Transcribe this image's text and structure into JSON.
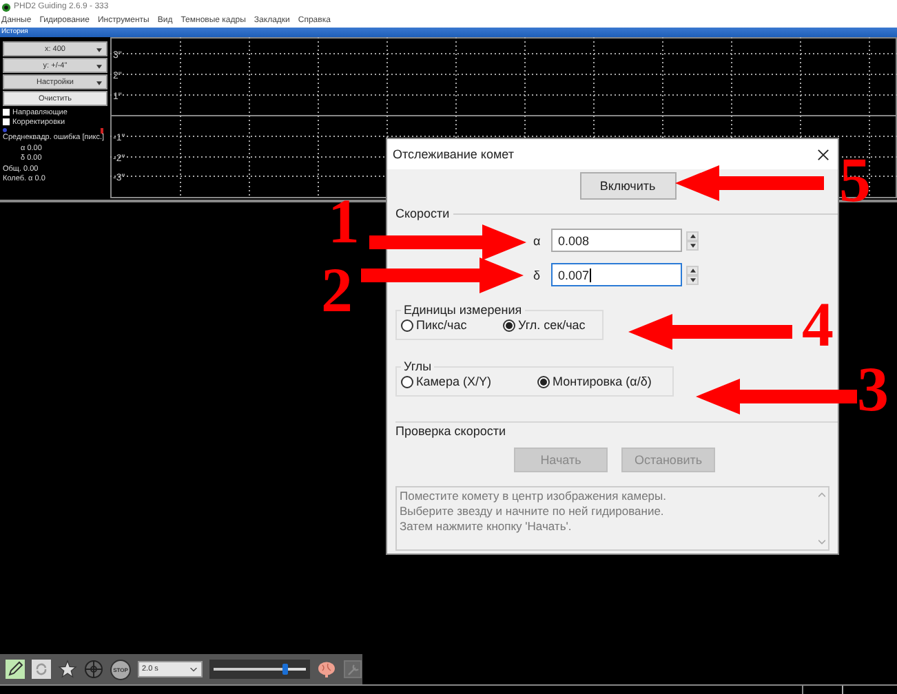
{
  "window": {
    "title": "PHD2 Guiding 2.6.9 - 333"
  },
  "menu": [
    "Данные",
    "Гидирование",
    "Инструменты",
    "Вид",
    "Темновые кадры",
    "Закладки",
    "Справка"
  ],
  "history": {
    "title": "История",
    "dropdowns": [
      "x: 400",
      "y: +/-4\"",
      "Настройки"
    ],
    "clear_button": "Очистить",
    "checkboxes": [
      {
        "label": "Направляющие",
        "checked": false
      },
      {
        "label": "Корректировки",
        "checked": false
      }
    ],
    "rms_label": "Среднеквадр. ошибка [пикс.]",
    "stats": [
      "α 0.00",
      "δ 0.00",
      "Общ. 0.00",
      "Колеб. α 0.0"
    ],
    "y_labels": [
      "3\"",
      "2\"",
      "1\"",
      "-1\"",
      "-2\"",
      "-3\""
    ]
  },
  "toolbar": {
    "stop_label": "STOP",
    "exposure": "2.0 s",
    "level": 0.77
  },
  "dialog": {
    "title": "Отслеживание комет",
    "enable_button": "Включить",
    "rates_label": "Скорости",
    "rates": [
      {
        "symbol": "α",
        "value": "0.008",
        "focused": false
      },
      {
        "symbol": "δ",
        "value": "0.007",
        "focused": true
      }
    ],
    "groups": [
      {
        "title": "Единицы измерения",
        "options": [
          {
            "label": "Пикс/час",
            "selected": false
          },
          {
            "label": "Угл. сек/час",
            "selected": true
          }
        ]
      },
      {
        "title": "Углы",
        "options": [
          {
            "label": "Камера (X/Y)",
            "selected": false
          },
          {
            "label": "Монтировка (α/δ)",
            "selected": true
          }
        ]
      }
    ],
    "check_label": "Проверка скорости",
    "check_buttons": [
      {
        "label": "Начать",
        "disabled": true
      },
      {
        "label": "Остановить",
        "disabled": true
      }
    ],
    "hint": "Поместите комету в центр изображения камеры.\nВыберите звезду и начните по ней гидирование.\nЗатем нажмите кнопку 'Начать'."
  },
  "annotations": [
    {
      "label": "5"
    },
    {
      "label": "1"
    },
    {
      "label": "2"
    },
    {
      "label": "4"
    },
    {
      "label": "3"
    }
  ]
}
